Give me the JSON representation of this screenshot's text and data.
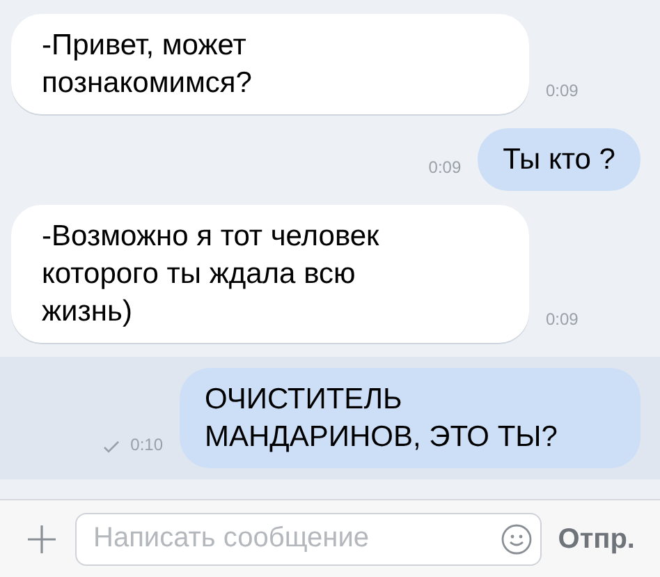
{
  "messages": [
    {
      "kind": "incoming",
      "text": "-Привет, может познакомимся?",
      "time": "0:09",
      "unread": false,
      "delivered": false
    },
    {
      "kind": "outgoing",
      "text": "Ты кто ?",
      "time": "0:09",
      "unread": false,
      "delivered": false
    },
    {
      "kind": "incoming",
      "text": "-Возможно я тот человек которого ты ждала всю жизнь)",
      "time": "0:09",
      "unread": false,
      "delivered": false
    },
    {
      "kind": "outgoing",
      "text": "ОЧИСТИТЕЛЬ МАНДАРИНОВ, ЭТО ТЫ?",
      "time": "0:10",
      "unread": true,
      "delivered": true
    }
  ],
  "composer": {
    "placeholder": "Написать сообщение",
    "send_label": "Отпр."
  }
}
